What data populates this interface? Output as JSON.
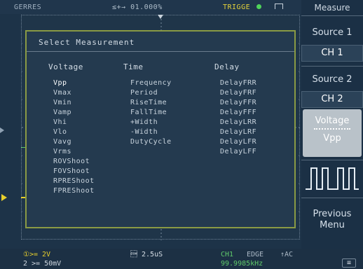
{
  "topbar": {
    "status": "GERRES",
    "timebase": "≤+→ 01.000%",
    "trigger": "TRIGGE"
  },
  "dialog": {
    "title": "Select Measurement",
    "columns": [
      {
        "header": "Voltage",
        "items": [
          "Vpp",
          "Vmax",
          "Vmin",
          "Vamp",
          "Vhi",
          "Vlo",
          "Vavg",
          "Vrms",
          "ROVShoot",
          "FOVShoot",
          "RPREShoot",
          "FPREShoot"
        ]
      },
      {
        "header": "Time",
        "items": [
          "Frequency",
          "Period",
          "RiseTime",
          "FallTime",
          "+Width",
          "-Width",
          "DutyCycle"
        ]
      },
      {
        "header": "Delay",
        "items": [
          "DelayFRR",
          "DelayFRF",
          "DelayFFR",
          "DelayFFF",
          "DelayLRR",
          "DelayLRF",
          "DelayLFR",
          "DelayLFF"
        ]
      }
    ],
    "selected": "Vpp"
  },
  "sidemenu": {
    "title": "Measure",
    "source1_label": "Source 1",
    "source1_value": "CH 1",
    "source2_label": "Source 2",
    "source2_value": "CH 2",
    "voltage_label": "Voltage",
    "voltage_value": "Vpp",
    "previous_menu": "Previous Menu"
  },
  "bottombar": {
    "ch1": "①>= 2V",
    "ch2": "2 >= 50mV",
    "timescale": "\u0001 2.5uS",
    "trig_src": "CH1",
    "trig_type": "EDGE",
    "trig_coupling": "↑AC",
    "freq": "99.9985kHz",
    "icon_label": "≡"
  },
  "colors": {
    "ch1": "#e7cf2c",
    "ch2": "#5fc96b",
    "dialog_border": "#8a9a44"
  }
}
